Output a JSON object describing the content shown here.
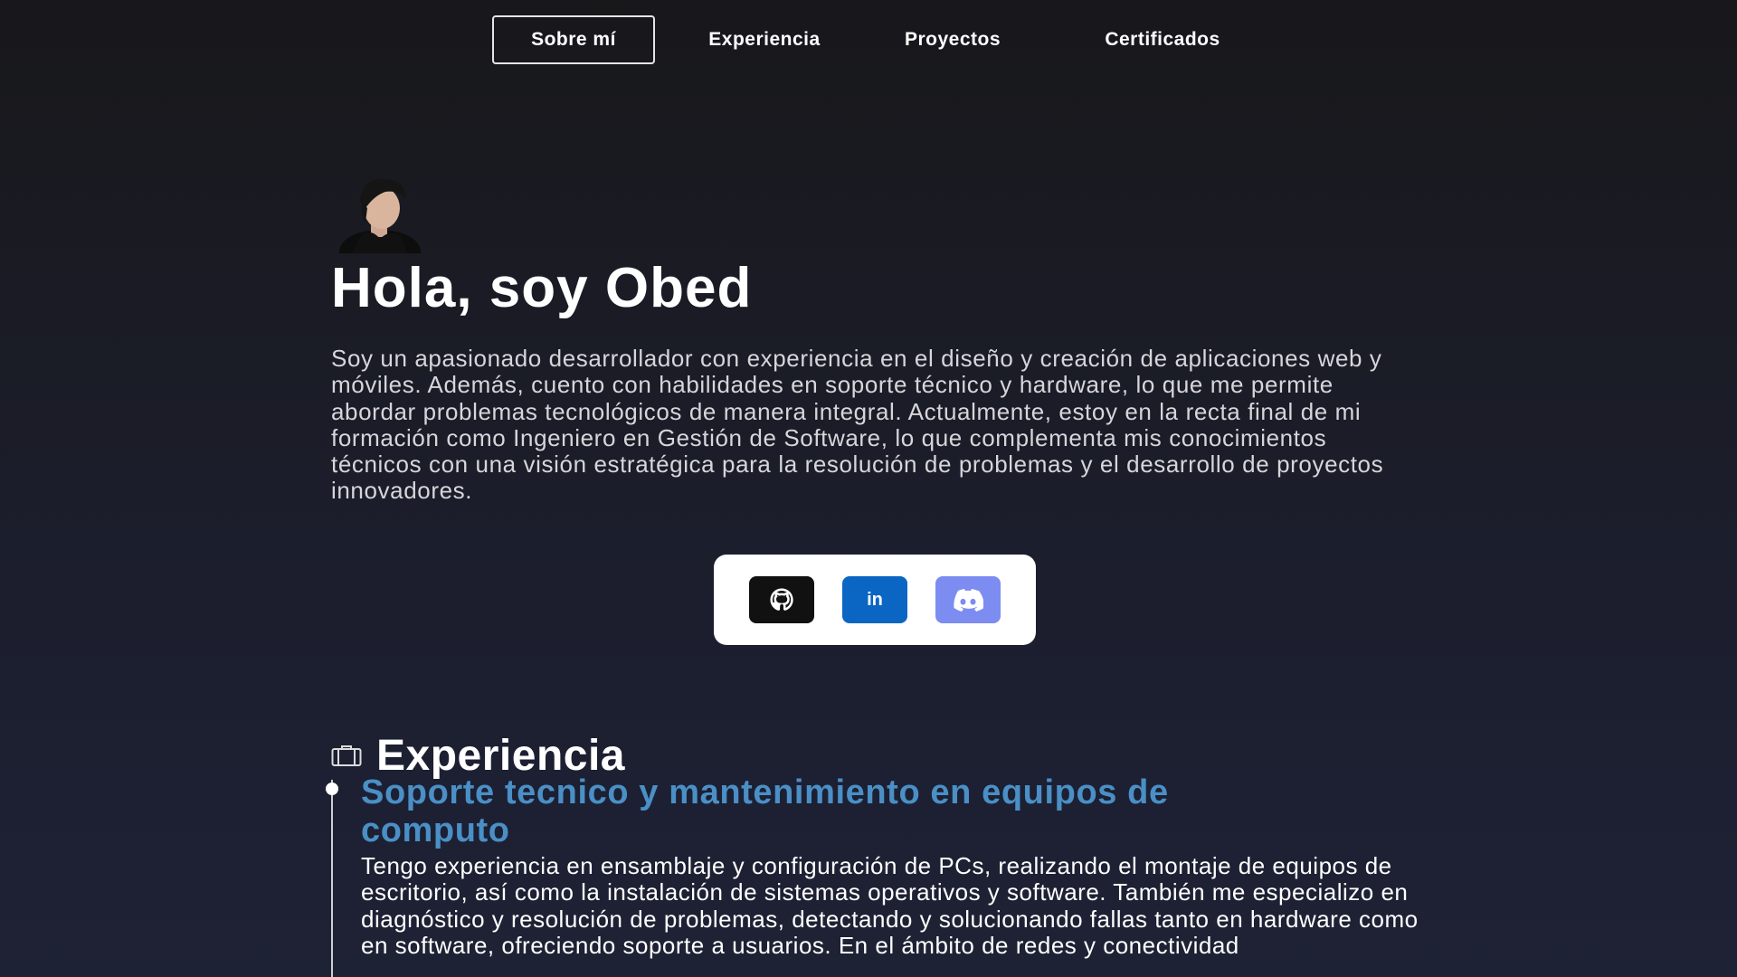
{
  "nav": {
    "items": [
      {
        "label": "Sobre mí"
      },
      {
        "label": "Experiencia"
      },
      {
        "label": "Proyectos"
      },
      {
        "label": "Certificados"
      }
    ]
  },
  "hero": {
    "avatar_icon": "profile-photo",
    "title": "Hola, soy Obed",
    "bio": "Soy un apasionado desarrollador con experiencia en el diseño y creación de aplicaciones web y móviles. Además, cuento con habilidades en soporte técnico y hardware, lo que me permite abordar problemas tecnológicos de manera integral. Actualmente, estoy en la recta final de mi formación como Ingeniero en Gestión de Software, lo que complementa mis conocimientos técnicos con una visión estratégica para la resolución de problemas y el desarrollo de proyectos innovadores."
  },
  "social": {
    "github_icon": "github-icon",
    "linkedin_text": "in",
    "discord_icon": "discord-icon",
    "colors": {
      "github": "#111111",
      "linkedin": "#0a66c2",
      "discord": "#7c8cf0"
    }
  },
  "experience": {
    "icon": "briefcase-icon",
    "heading": "Experiencia",
    "jobs": [
      {
        "title": "Soporte tecnico y mantenimiento en equipos de computo",
        "description": "Tengo experiencia en ensamblaje y configuración de PCs, realizando el montaje de equipos de escritorio, así como la instalación de sistemas operativos y software. También me especializo en diagnóstico y resolución de problemas, detectando y solucionando fallas tanto en hardware como en software, ofreciendo soporte a usuarios. En el ámbito de redes y conectividad"
      }
    ]
  },
  "colors": {
    "accent": "#4a8fc6",
    "background": "#1c1f30"
  }
}
